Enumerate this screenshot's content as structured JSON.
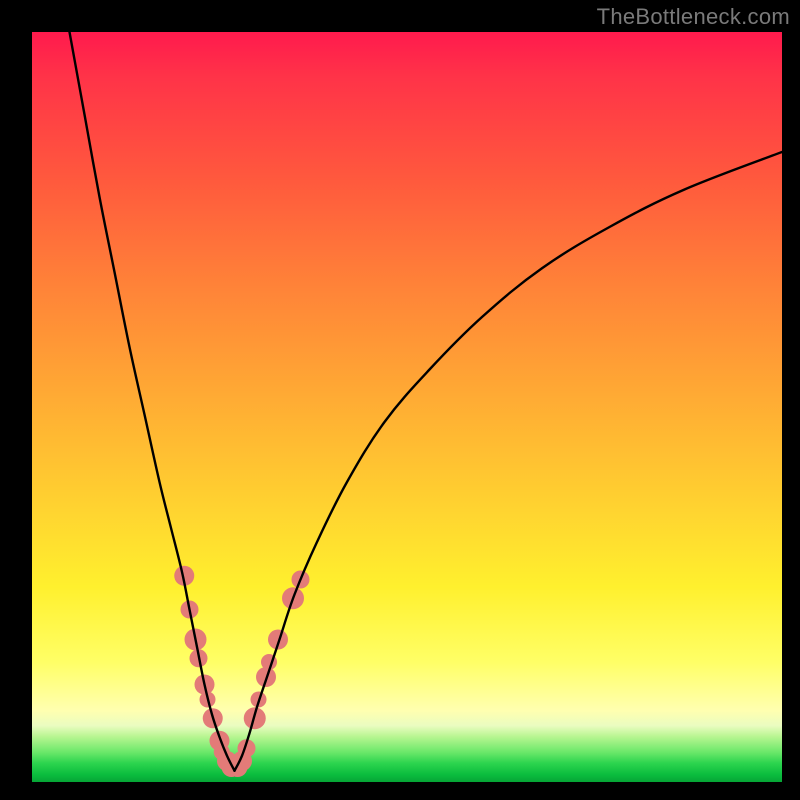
{
  "watermark": "TheBottleneck.com",
  "chart_data": {
    "type": "line",
    "title": "",
    "xlabel": "",
    "ylabel": "",
    "xlim": [
      0,
      100
    ],
    "ylim": [
      0,
      100
    ],
    "grid": false,
    "legend": false,
    "series": [
      {
        "name": "left-curve",
        "x": [
          5,
          7,
          9,
          11,
          13,
          15,
          17,
          18.5,
          20,
          21,
          22,
          23,
          24,
          25,
          26,
          27
        ],
        "values": [
          100,
          89,
          78,
          68,
          58,
          49,
          40,
          34,
          28,
          23,
          18,
          13,
          9,
          6,
          3.5,
          1.5
        ]
      },
      {
        "name": "right-curve",
        "x": [
          27,
          28,
          29,
          30,
          31.5,
          33,
          35,
          38,
          42,
          47,
          53,
          60,
          68,
          77,
          87,
          100
        ],
        "values": [
          1.5,
          3.5,
          6.5,
          10,
          14.5,
          19,
          25,
          32,
          40,
          48,
          55,
          62,
          68.5,
          74,
          79,
          84
        ]
      }
    ],
    "markers": {
      "name": "highlight-dots",
      "color": "#e37b78",
      "points": [
        {
          "x": 20.3,
          "y": 27.5,
          "r": 10
        },
        {
          "x": 21.0,
          "y": 23.0,
          "r": 9
        },
        {
          "x": 21.8,
          "y": 19.0,
          "r": 11
        },
        {
          "x": 22.2,
          "y": 16.5,
          "r": 9
        },
        {
          "x": 23.0,
          "y": 13.0,
          "r": 10
        },
        {
          "x": 23.4,
          "y": 11.0,
          "r": 8
        },
        {
          "x": 24.1,
          "y": 8.5,
          "r": 10
        },
        {
          "x": 25.0,
          "y": 5.5,
          "r": 10
        },
        {
          "x": 25.3,
          "y": 4.0,
          "r": 8
        },
        {
          "x": 26.0,
          "y": 2.8,
          "r": 10
        },
        {
          "x": 26.6,
          "y": 2.0,
          "r": 10
        },
        {
          "x": 27.4,
          "y": 2.0,
          "r": 10
        },
        {
          "x": 28.0,
          "y": 2.8,
          "r": 10
        },
        {
          "x": 28.6,
          "y": 4.5,
          "r": 9
        },
        {
          "x": 29.7,
          "y": 8.5,
          "r": 11
        },
        {
          "x": 30.2,
          "y": 11.0,
          "r": 8
        },
        {
          "x": 31.2,
          "y": 14.0,
          "r": 10
        },
        {
          "x": 31.6,
          "y": 16.0,
          "r": 8
        },
        {
          "x": 32.8,
          "y": 19.0,
          "r": 10
        },
        {
          "x": 34.8,
          "y": 24.5,
          "r": 11
        },
        {
          "x": 35.8,
          "y": 27.0,
          "r": 9
        }
      ]
    }
  }
}
